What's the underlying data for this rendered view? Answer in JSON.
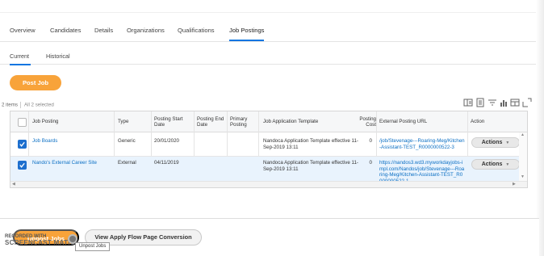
{
  "main_tabs": [
    "Overview",
    "Candidates",
    "Details",
    "Organizations",
    "Qualifications",
    "Job Postings"
  ],
  "main_tab_active": "Job Postings",
  "sub_tabs": [
    "Current",
    "Historical"
  ],
  "sub_tab_active": "Current",
  "post_job_label": "Post Job",
  "items": {
    "count": "2 items",
    "selected": "All 2 selected"
  },
  "toolbar_icons": [
    "export-excel-icon",
    "export-pdf-icon",
    "filter-icon",
    "chart-icon",
    "table-view-icon",
    "fullscreen-icon"
  ],
  "columns": [
    "Job Posting",
    "Type",
    "Posting Start Date",
    "Posting End Date",
    "Primary Posting",
    "Job Application Template",
    "Posting Cost",
    "External Posting URL",
    "Action"
  ],
  "rows": [
    {
      "checked": true,
      "job_posting": "Job Boards",
      "type": "Generic",
      "start": "20/01/2020",
      "end": "",
      "primary": "",
      "template": "Nandoca Application Template effective 11-Sep-2019 13:11",
      "cost": "0",
      "url": "/job/Stevenage---Roaring-Meg/Kitchen-Assistant-TEST_R0000000522-3",
      "action": "Actions"
    },
    {
      "checked": true,
      "job_posting": "Nando's External Career Site",
      "type": "External",
      "start": "04/11/2019",
      "end": "",
      "primary": "",
      "template": "Nandoca Application Template effective 11-Sep-2019 13:11",
      "cost": "0",
      "url": "https://nandos3.wd3.myworkdayjobs-impl.com/Nandos/job/Stevenage---Roaring-Meg/Kitchen-Assistant-TEST_R0000000522-1",
      "action": "Actions"
    }
  ],
  "bottom": {
    "unpost_label": "Unpost Jobs",
    "flow_label": "View Apply Flow Page Conversion",
    "tooltip": "Unpost Jobs"
  },
  "watermark": {
    "line1": "RECORDED WITH",
    "line2": "SCREENCAST",
    "line3": "MATIC"
  },
  "colors": {
    "accent": "#0875e1",
    "primary_button": "#f8a33a",
    "link": "#0b6fc4",
    "selected_row": "#e9f3fd"
  }
}
